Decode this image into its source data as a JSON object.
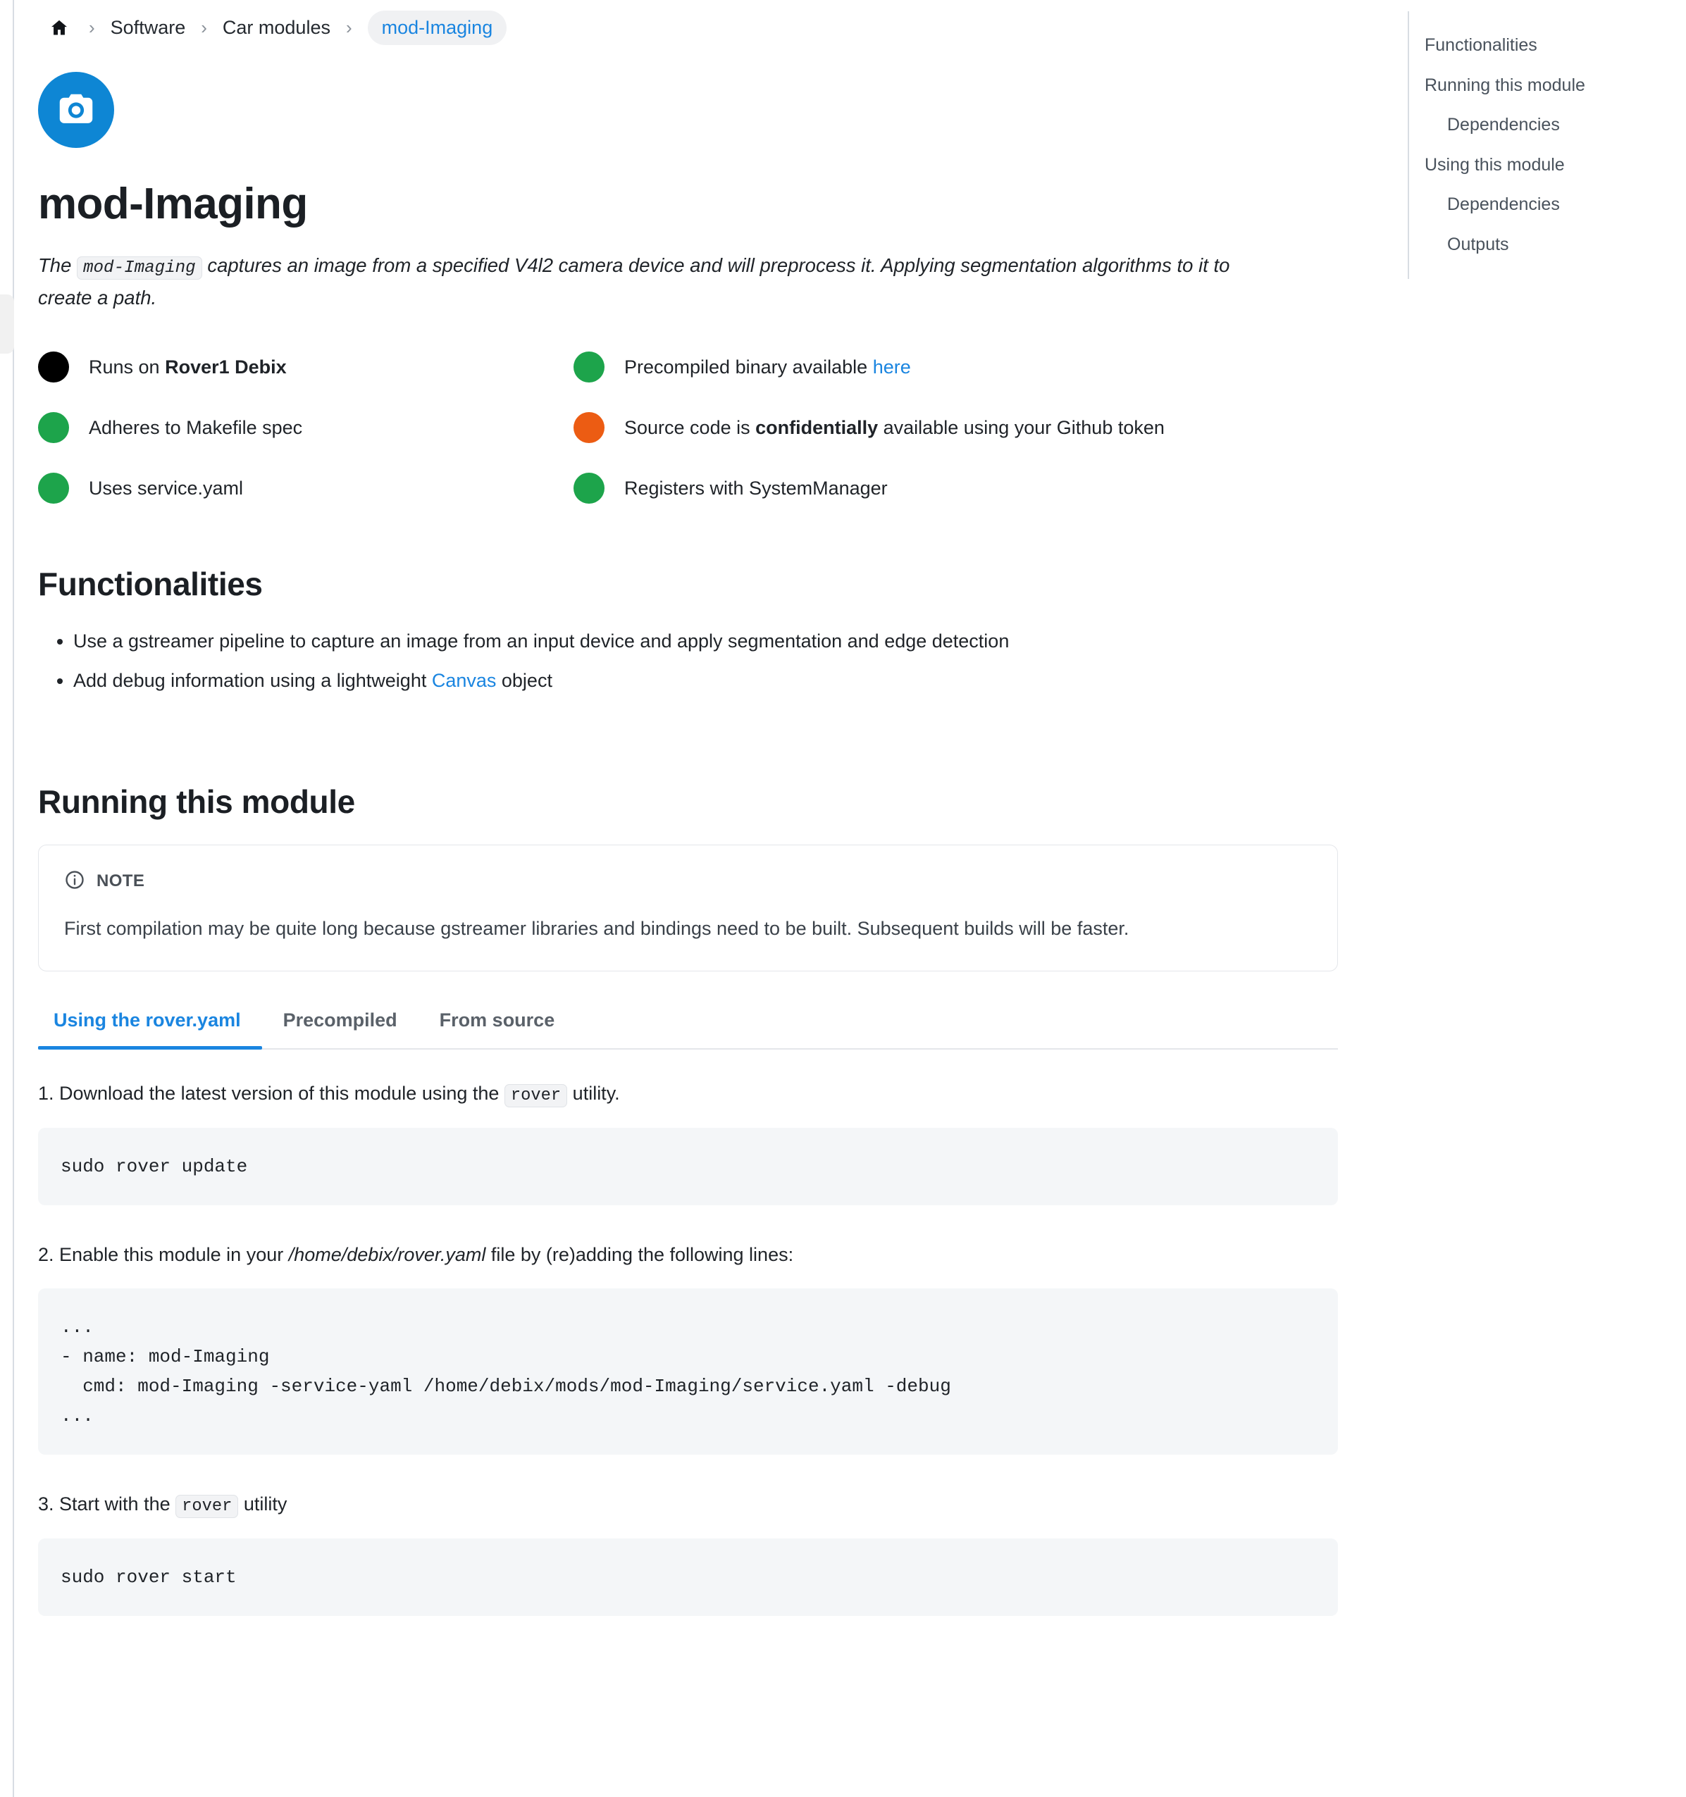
{
  "breadcrumb": {
    "home_icon": "home-icon",
    "separator": "›",
    "items": [
      {
        "label": "Software",
        "current": false
      },
      {
        "label": "Car modules",
        "current": false
      },
      {
        "label": "mod-Imaging",
        "current": true
      }
    ]
  },
  "header": {
    "icon": "camera-icon",
    "icon_bg": "#0e86d4",
    "title": "mod-Imaging",
    "lede_before": "The ",
    "lede_code": "mod-Imaging",
    "lede_after": " captures an image from a specified V4l2 camera device and will preprocess it. Applying segmentation algorithms to it to create a path."
  },
  "status": {
    "colors": {
      "black": "#000000",
      "green": "#1da44b",
      "orange": "#ec5c13"
    },
    "items": [
      {
        "color": "#000000",
        "color_name": "black",
        "text_before": "Runs on ",
        "bold": "Rover1 Debix",
        "text_after": "",
        "link": "",
        "column": "left"
      },
      {
        "color": "#1da44b",
        "color_name": "green",
        "text_before": "Adheres to Makefile spec",
        "bold": "",
        "text_after": "",
        "link": "",
        "column": "left"
      },
      {
        "color": "#1da44b",
        "color_name": "green",
        "text_before": "Uses service.yaml",
        "bold": "",
        "text_after": "",
        "link": "",
        "column": "left"
      },
      {
        "color": "#1da44b",
        "color_name": "green",
        "text_before": "Precompiled binary available ",
        "bold": "",
        "text_after": "",
        "link": "here",
        "column": "right"
      },
      {
        "color": "#ec5c13",
        "color_name": "orange",
        "text_before": "Source code is ",
        "bold": "confidentially",
        "text_after": " available using your Github token",
        "link": "",
        "column": "right"
      },
      {
        "color": "#1da44b",
        "color_name": "green",
        "text_before": "Registers with SystemManager",
        "bold": "",
        "text_after": "",
        "link": "",
        "column": "right"
      }
    ]
  },
  "functionalities": {
    "heading": "Functionalities",
    "items": [
      {
        "text_before": "Use a gstreamer pipeline to capture an image from an input device and apply segmentation and edge detection",
        "link": "",
        "text_after": ""
      },
      {
        "text_before": "Add debug information using a lightweight ",
        "link": "Canvas",
        "text_after": " object"
      }
    ]
  },
  "running": {
    "heading": "Running this module",
    "note": {
      "icon": "info-icon",
      "label": "NOTE",
      "body": "First compilation may be quite long because gstreamer libraries and bindings need to be built. Subsequent builds will be faster."
    },
    "tabs": [
      {
        "label": "Using the rover.yaml",
        "active": true
      },
      {
        "label": "Precompiled",
        "active": false
      },
      {
        "label": "From source",
        "active": false
      }
    ],
    "steps": [
      {
        "number": "1.",
        "text_before": " Download the latest version of this module using the ",
        "code": "rover",
        "text_after": " utility.",
        "block": "sudo rover update"
      },
      {
        "number": "2.",
        "text_before": " Enable this module in your ",
        "italic": "/home/debix/rover.yaml",
        "text_after": " file by (re)adding the following lines:",
        "block": "...\n- name: mod-Imaging\n  cmd: mod-Imaging -service-yaml /home/debix/mods/mod-Imaging/service.yaml -debug\n..."
      },
      {
        "number": "3.",
        "text_before": " Start with the ",
        "code": "rover",
        "text_after": " utility",
        "block": "sudo rover start"
      }
    ]
  },
  "toc": {
    "items": [
      {
        "label": "Functionalities",
        "level": 1
      },
      {
        "label": "Running this module",
        "level": 1
      },
      {
        "label": "Dependencies",
        "level": 2
      },
      {
        "label": "Using this module",
        "level": 1
      },
      {
        "label": "Dependencies",
        "level": 2
      },
      {
        "label": "Outputs",
        "level": 2
      }
    ]
  }
}
